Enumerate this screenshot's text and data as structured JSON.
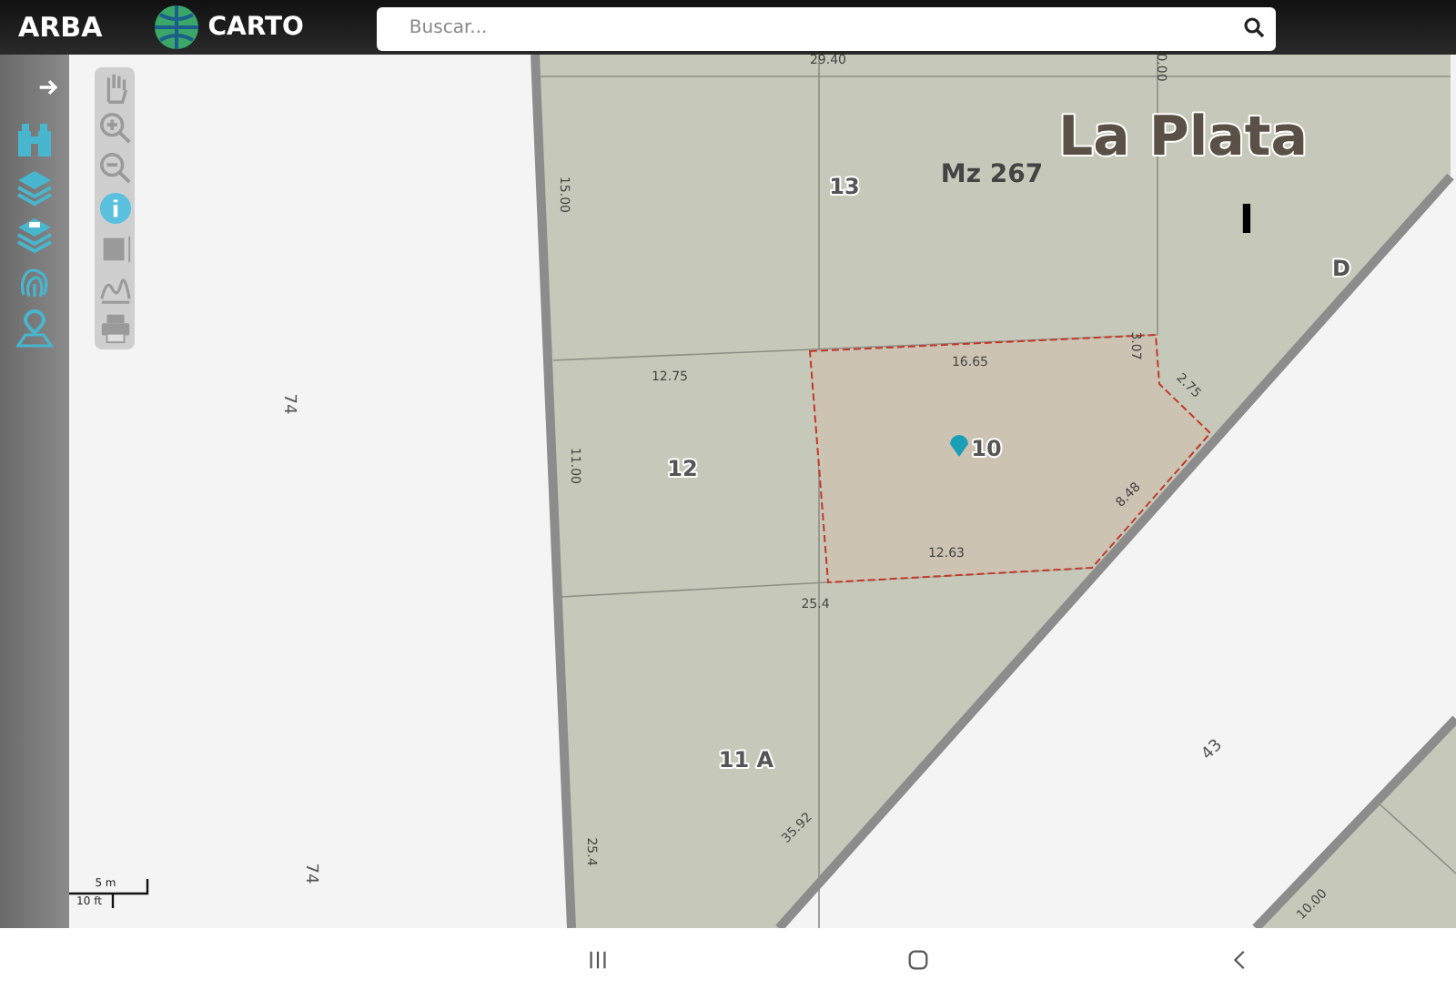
{
  "header": {
    "logo": "ARBA",
    "brand": "CARTO",
    "search": {
      "placeholder": "Buscar..."
    }
  },
  "sidebar": {
    "items": [
      {
        "kind": "arrow"
      },
      {
        "kind": "binoculars"
      },
      {
        "kind": "layers"
      },
      {
        "kind": "layers-badge"
      },
      {
        "kind": "fingerprint"
      },
      {
        "kind": "pin"
      }
    ]
  },
  "toolbar": {
    "items": [
      {
        "kind": "hand",
        "selected": false
      },
      {
        "kind": "zoom-in",
        "selected": false
      },
      {
        "kind": "zoom-out",
        "selected": false
      },
      {
        "kind": "info",
        "selected": true
      },
      {
        "kind": "area",
        "selected": false
      },
      {
        "kind": "profile",
        "selected": false
      },
      {
        "kind": "print",
        "selected": false
      }
    ]
  },
  "map": {
    "labels": [
      {
        "text": "La Plata",
        "kind": "city"
      },
      {
        "text": "13",
        "kind": "lot"
      },
      {
        "text": "Mz 267",
        "kind": "block"
      },
      {
        "text": "I",
        "kind": "mark"
      },
      {
        "text": "D",
        "kind": "lot"
      },
      {
        "text": "12",
        "kind": "lot"
      },
      {
        "text": "10",
        "kind": "lot"
      },
      {
        "text": "11 A",
        "kind": "lot"
      },
      {
        "text": "29.40",
        "kind": "dim"
      },
      {
        "text": "0.00",
        "kind": "dim"
      },
      {
        "text": "15.00",
        "kind": "dim"
      },
      {
        "text": "12.75",
        "kind": "dim"
      },
      {
        "text": "16.65",
        "kind": "dim"
      },
      {
        "text": "3.07",
        "kind": "dim"
      },
      {
        "text": "2.75",
        "kind": "dim"
      },
      {
        "text": "11.00",
        "kind": "dim"
      },
      {
        "text": "8.48",
        "kind": "dim"
      },
      {
        "text": "12.63",
        "kind": "dim"
      },
      {
        "text": "25.4",
        "kind": "dim"
      },
      {
        "text": "74",
        "kind": "street"
      },
      {
        "text": "74",
        "kind": "street"
      },
      {
        "text": "35.92",
        "kind": "dim"
      },
      {
        "text": "25.4",
        "kind": "dim"
      },
      {
        "text": "43",
        "kind": "street"
      },
      {
        "text": "10.00",
        "kind": "dim"
      }
    ],
    "scale": {
      "metric": "5 m",
      "imperial": "10 ft"
    }
  },
  "nav_bar": {
    "items": [
      {
        "kind": "recents"
      },
      {
        "kind": "home"
      },
      {
        "kind": "back"
      }
    ]
  }
}
